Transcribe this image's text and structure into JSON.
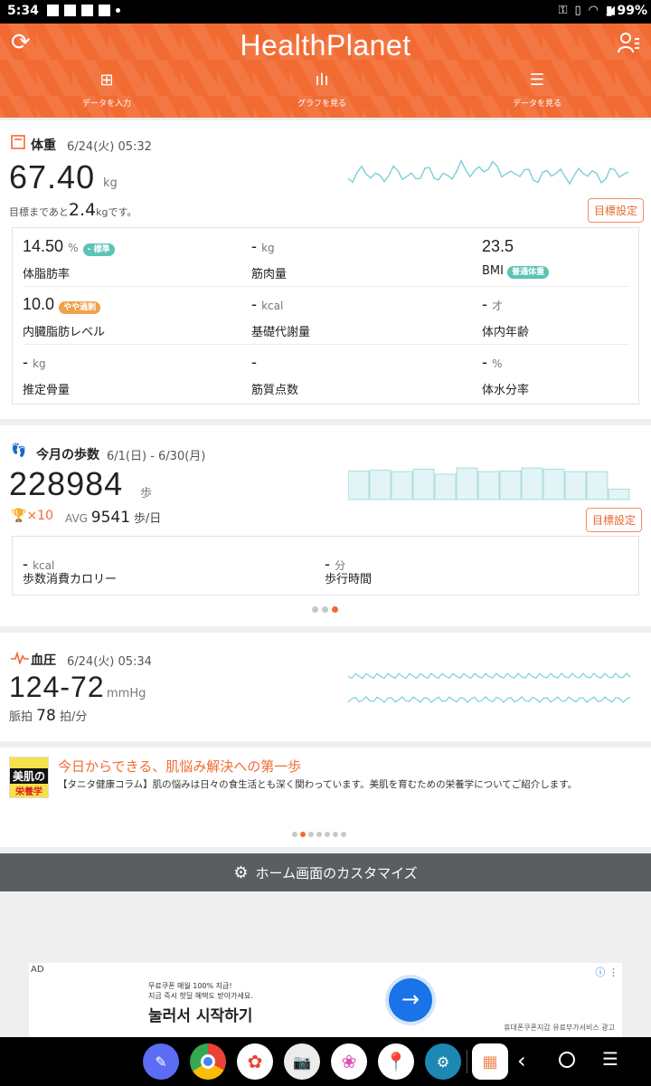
{
  "status": {
    "time": "5:34",
    "battery": "99%"
  },
  "header": {
    "logo": "HealthPlanet",
    "nav": [
      {
        "label": "データを入力"
      },
      {
        "label": "グラフを見る"
      },
      {
        "label": "データを見る"
      }
    ]
  },
  "weight": {
    "title": "体重",
    "date": "6/24(火) 05:32",
    "value": "67.40",
    "unit": "kg",
    "goal_prefix": "目標まであと",
    "goal_value": "2.4",
    "goal_unit": "kg",
    "goal_suffix": "です。",
    "goal_button": "目標設定",
    "metrics": [
      {
        "value": "14.50",
        "unit": "%",
        "badge": "- 標準",
        "label": "体脂肪率"
      },
      {
        "value": "-",
        "unit": "kg",
        "badge": "",
        "label": "筋肉量"
      },
      {
        "value": "23.5",
        "unit": "",
        "badge": "",
        "label": "BMI",
        "label_badge": "普通体重"
      },
      {
        "value": "10.0",
        "unit": "",
        "badge": "やや過剰",
        "label": "内臓脂肪レベル"
      },
      {
        "value": "-",
        "unit": "kcal",
        "badge": "",
        "label": "基礎代謝量"
      },
      {
        "value": "-",
        "unit": "才",
        "badge": "",
        "label": "体内年齢"
      },
      {
        "value": "-",
        "unit": "kg",
        "badge": "",
        "label": "推定骨量"
      },
      {
        "value": "-",
        "unit": "",
        "badge": "",
        "label": "筋質点数"
      },
      {
        "value": "-",
        "unit": "%",
        "badge": "",
        "label": "体水分率"
      }
    ]
  },
  "steps": {
    "title": "今月の歩数",
    "date": "6/1(日) - 6/30(月)",
    "value": "228984",
    "unit": "歩",
    "trophy": "×10",
    "avg_label": "AVG",
    "avg_value": "9541",
    "avg_unit": "歩/日",
    "goal_button": "目標設定",
    "kcal_value": "-",
    "kcal_unit": "kcal",
    "kcal_label": "歩数消費カロリー",
    "time_value": "-",
    "time_unit": "分",
    "time_label": "歩行時間",
    "bars": [
      0.88,
      0.9,
      0.86,
      0.93,
      0.78,
      0.97,
      0.86,
      0.88,
      0.97,
      0.93,
      0.86,
      0.86,
      0.32
    ]
  },
  "bp": {
    "title": "血圧",
    "date": "6/24(火) 05:34",
    "value": "124-72",
    "unit": "mmHg",
    "pulse_label": "脈拍",
    "pulse_value": "78",
    "pulse_unit": "拍/分"
  },
  "article": {
    "thumb_line1": "美肌の",
    "thumb_line2": "栄養学",
    "title": "今日からできる、肌悩み解決への第一歩",
    "body": "【タニタ健康コラム】肌の悩みは日々の食生活とも深く関わっています。美肌を育むための栄養学についてご紹介します。"
  },
  "customize": {
    "label": "ホーム画面のカスタマイズ"
  },
  "ad": {
    "tag": "AD",
    "line1": "무료쿠폰 매월 100% 지급!",
    "line2": "지금 즉시 핫딜 혜택도 받아가세요.",
    "headline": "눌러서 시작하기",
    "footer": "휴대폰쿠폰지갑 유료부가서비스 광고"
  },
  "colors": {
    "accent": "#f26b33",
    "teal": "#5bc4b4",
    "chart": "#7ccfd3"
  }
}
